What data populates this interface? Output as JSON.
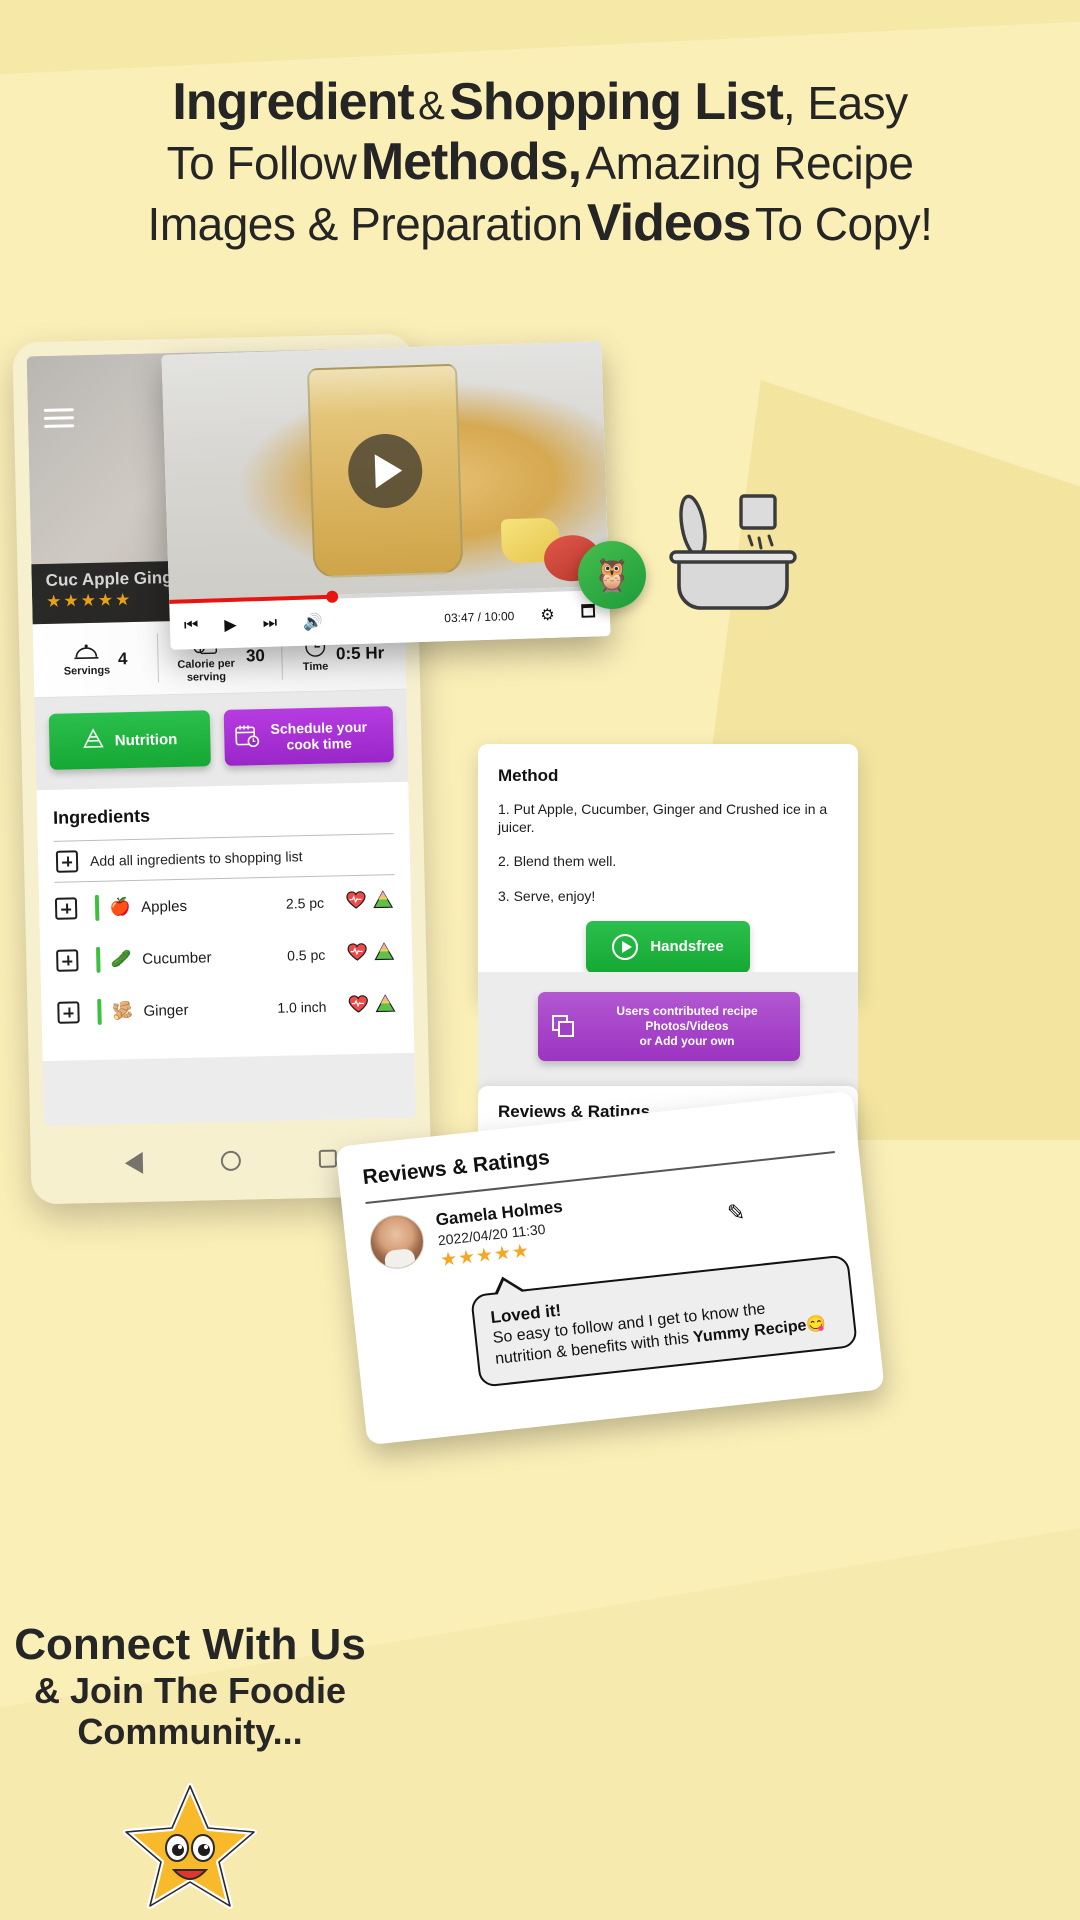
{
  "theme": {
    "background": "#fbefb8",
    "wedge": "#f3e4a0",
    "green": "#16a833",
    "purple": "#9c34c1",
    "red_progress": "#e8140f",
    "star_gold": "#f5a623",
    "text_dark": "#252525"
  },
  "headline": {
    "line1_a": "Ingredient",
    "line1_amp": "&",
    "line1_b": "Shopping List",
    "line1_c": ", Easy",
    "line2_a": "To Follow",
    "line2_b": "Methods,",
    "line2_c": "Amazing Recipe",
    "line3_a": "Images & Preparation",
    "line3_b": "Videos",
    "line3_c": "To Copy!"
  },
  "app": {
    "menu_icon": "hamburger-icon",
    "hero": {
      "title": "Cuc Apple Ginger",
      "stars": "★★★★★"
    },
    "stats": [
      {
        "icon": "serving-dome-icon",
        "label": "Servings",
        "value": "4"
      },
      {
        "icon": "calorie-calculator-icon",
        "label": "Calorie per serving",
        "value": "30"
      },
      {
        "icon": "clock-icon",
        "label": "Time",
        "value": "0:5 Hr"
      }
    ],
    "buttons": {
      "nutrition": "Nutrition",
      "nutrition_icon": "pyramid-icon",
      "schedule_line1": "Schedule your",
      "schedule_line2": "cook time",
      "schedule_icon": "calendar-clock-icon"
    },
    "ingredients": {
      "title": "Ingredients",
      "add_all": "Add all ingredients to shopping list",
      "add_all_icon": "plus-box-icon",
      "items": [
        {
          "emoji": "🍎",
          "name": "Apples",
          "qty": "2.5 pc",
          "health_icon": "heartbeat-icon",
          "pyramid_icon": "food-pyramid-icon"
        },
        {
          "emoji": "🥒",
          "name": "Cucumber",
          "qty": "0.5 pc",
          "health_icon": "heartbeat-icon",
          "pyramid_icon": "food-pyramid-icon"
        },
        {
          "emoji": "🫚",
          "name": "Ginger",
          "qty": "1.0 inch",
          "health_icon": "heartbeat-icon",
          "pyramid_icon": "food-pyramid-icon"
        }
      ]
    },
    "nav": {
      "back": "back-triangle-icon",
      "home": "home-circle-icon",
      "recents": "recents-square-icon"
    }
  },
  "video_player": {
    "play_icon": "play-icon",
    "prev_icon": "skip-previous-icon",
    "play_small_icon": "play-icon",
    "next_icon": "skip-next-icon",
    "volume_icon": "volume-icon",
    "settings_icon": "gear-icon",
    "fullscreen_icon": "fullscreen-icon",
    "timestamp": "03:47 / 10:00",
    "progress_percent": 37
  },
  "owl_badge": {
    "icon": "owl-icon",
    "glyph": "🦉"
  },
  "pot_doodle": {
    "icon": "cooking-pot-icon"
  },
  "method": {
    "title": "Method",
    "steps": [
      "1. Put Apple, Cucumber, Ginger and Crushed ice in a juicer.",
      "2. Blend them well.",
      "3. Serve, enjoy!"
    ],
    "handsfree_label": "Handsfree",
    "handsfree_icon": "play-circle-icon"
  },
  "contributed": {
    "line1": "Users contributed recipe Photos/Videos",
    "line2": "or Add your own",
    "icon": "photo-stack-icon"
  },
  "reviews": {
    "section_title_behind": "Reviews & Ratings",
    "section_title": "Reviews & Ratings",
    "edit_icon": "pencil-icon",
    "avatar_icon": "avatar",
    "entry": {
      "name": "Gamela Holmes",
      "date": "2022/04/20 11:30",
      "stars": "★★★★★",
      "bubble_heading": "Loved it!",
      "bubble_text_1": "So easy to follow and I get to know the",
      "bubble_text_2_pre": "nutrition & benefits with this ",
      "bubble_text_2_bold": "Yummy Recipe",
      "bubble_emoji": "😋"
    }
  },
  "connect": {
    "line1": "Connect With Us",
    "line2": "& Join The Foodie",
    "line3": "Community...",
    "mascot_icon": "smiling-star-icon"
  }
}
